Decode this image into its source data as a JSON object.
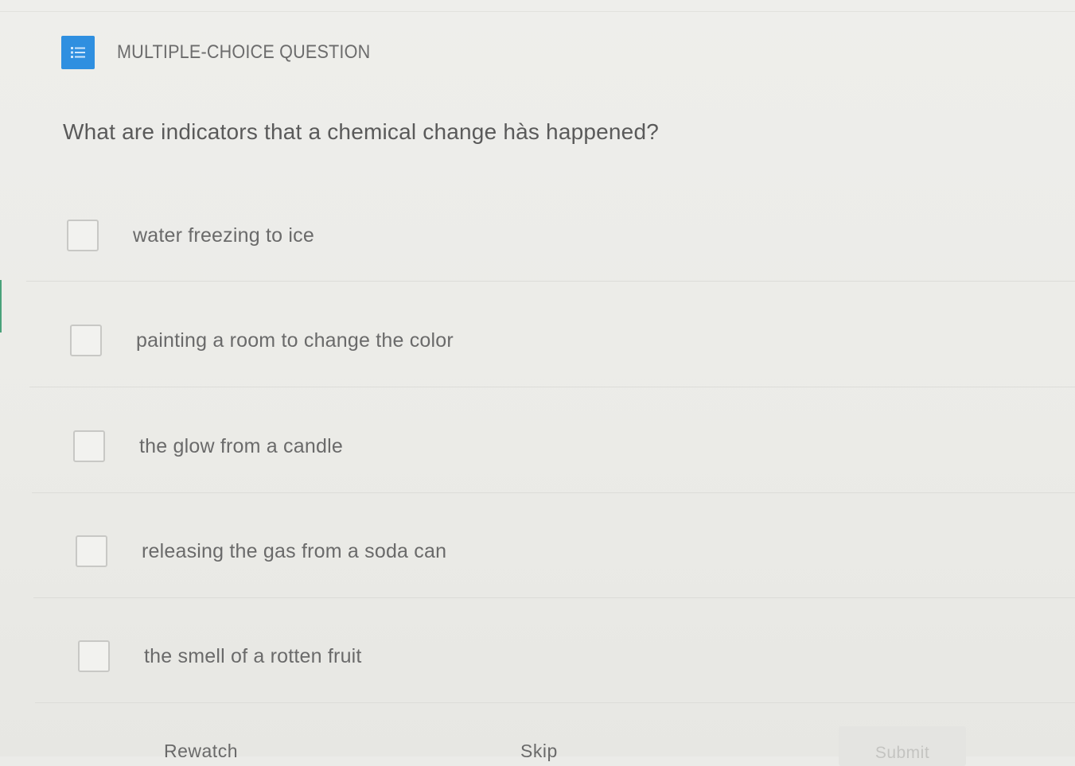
{
  "header": {
    "icon": "list-icon",
    "label": "MULTIPLE-CHOICE QUESTION",
    "accent_color": "#2f8fe0"
  },
  "question": {
    "text": "What are indicators that a chemical change hàs happened?"
  },
  "options": [
    {
      "label": "water freezing to ice",
      "checked": false
    },
    {
      "label": "painting a room to change the color",
      "checked": false
    },
    {
      "label": "the glow from a candle",
      "checked": false
    },
    {
      "label": "releasing the gas from a soda can",
      "checked": false
    },
    {
      "label": "the smell of a rotten fruit",
      "checked": false
    }
  ],
  "footer": {
    "rewatch_label": "Rewatch",
    "skip_label": "Skip",
    "submit_label": "Submit"
  }
}
